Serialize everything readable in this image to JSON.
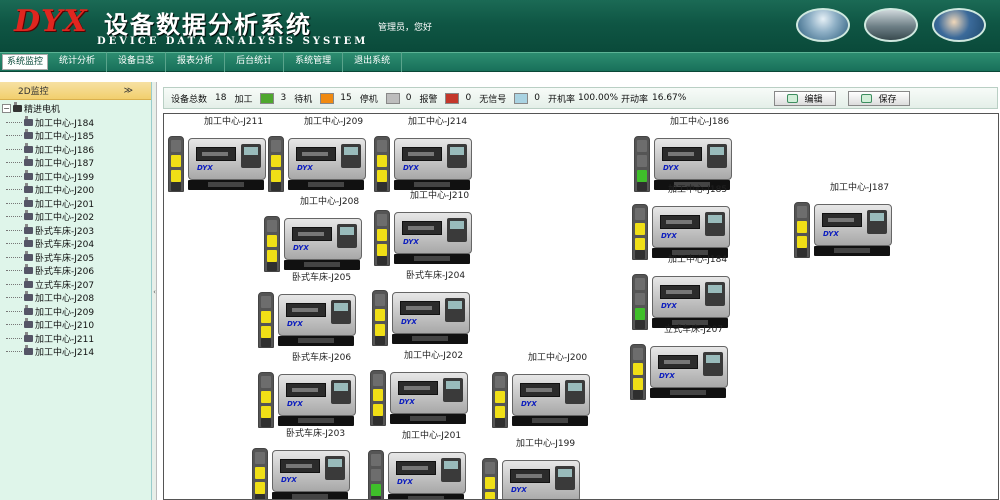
{
  "header": {
    "logo": "DYX",
    "title_cn": "设备数据分析系统",
    "title_en": "DEVICE DATA ANALYSIS SYSTEM",
    "user": "管理员，您好"
  },
  "menu": [
    "系统监控",
    "统计分析",
    "设备日志",
    "报表分析",
    "后台统计",
    "系统管理",
    "退出系统"
  ],
  "sidebar": {
    "tab_label": "2D监控",
    "collapse_glyph": "≫",
    "root": "精进电机",
    "items": [
      "加工中心-J184",
      "加工中心-J185",
      "加工中心-J186",
      "加工中心-J187",
      "加工中心-J199",
      "加工中心-J200",
      "加工中心-J201",
      "加工中心-J202",
      "卧式车床-J203",
      "卧式车床-J204",
      "卧式车床-J205",
      "卧式车床-J206",
      "立式车床-J207",
      "加工中心-J208",
      "加工中心-J209",
      "加工中心-J210",
      "加工中心-J211",
      "加工中心-J214"
    ]
  },
  "status": {
    "total_label": "设备总数",
    "total": "18",
    "processing_label": "加工",
    "processing": "3",
    "standby_label": "待机",
    "standby": "15",
    "stopped_label": "停机",
    "stopped": "0",
    "alarm_label": "报警",
    "alarm": "0",
    "nosignal_label": "无信号",
    "nosignal": "0",
    "power_rate_label": "开机率",
    "power_rate": "100.00%",
    "run_rate_label": "开动率",
    "run_rate": "16.67%",
    "edit_label": "编辑",
    "save_label": "保存",
    "colors": {
      "processing": "#4ea72e",
      "standby": "#f08a11",
      "stopped": "#bdbdbd",
      "alarm": "#c4372b",
      "nosignal": "#a9d3e2"
    }
  },
  "brand": {
    "mark": "DYX"
  },
  "machines": [
    {
      "label": "加工中心-J211",
      "state": "standby"
    },
    {
      "label": "加工中心-J209",
      "state": "standby"
    },
    {
      "label": "加工中心-J214",
      "state": "standby"
    },
    {
      "label": "加工中心-J186",
      "state": "processing"
    },
    {
      "label": "加工中心-J208",
      "state": "standby"
    },
    {
      "label": "加工中心-J210",
      "state": "standby"
    },
    {
      "label": "加工中心-J185",
      "state": "standby"
    },
    {
      "label": "加工中心-J187",
      "state": "standby"
    },
    {
      "label": "卧式车床-J205",
      "state": "standby"
    },
    {
      "label": "卧式车床-J204",
      "state": "standby"
    },
    {
      "label": "加工中心-J184",
      "state": "processing"
    },
    {
      "label": "卧式车床-J206",
      "state": "standby"
    },
    {
      "label": "加工中心-J202",
      "state": "standby"
    },
    {
      "label": "加工中心-J200",
      "state": "standby"
    },
    {
      "label": "立式车床-J207",
      "state": "standby"
    },
    {
      "label": "卧式车床-J203",
      "state": "standby"
    },
    {
      "label": "加工中心-J201",
      "state": "processing"
    },
    {
      "label": "加工中心-J199",
      "state": "standby"
    }
  ]
}
